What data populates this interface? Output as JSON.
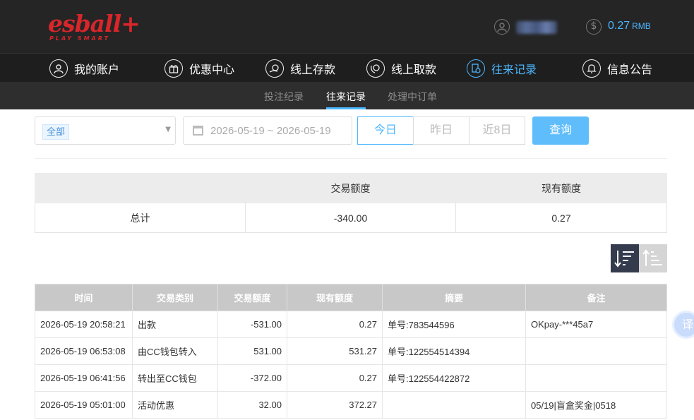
{
  "brand": {
    "logo_text": "esball+",
    "tagline": "PLAY SMART",
    "color": "#d8262b"
  },
  "header": {
    "balance": "0.27",
    "currency": "RMB",
    "accent": "#4cb6ff"
  },
  "nav": [
    {
      "label": "我的账户",
      "icon": "user-icon"
    },
    {
      "label": "优惠中心",
      "icon": "gift-icon"
    },
    {
      "label": "线上存款",
      "icon": "deposit-icon"
    },
    {
      "label": "线上取款",
      "icon": "withdraw-icon"
    },
    {
      "label": "往来记录",
      "icon": "records-icon",
      "active": true
    },
    {
      "label": "信息公告",
      "icon": "bell-icon"
    }
  ],
  "subnav": [
    {
      "label": "投注纪录"
    },
    {
      "label": "往来记录",
      "active": true
    },
    {
      "label": "处理中订单"
    }
  ],
  "filters": {
    "type_value": "全部",
    "date_range": "2026-05-19 ~ 2026-05-19",
    "quick": [
      "今日",
      "昨日",
      "近8日"
    ],
    "search_label": "查询"
  },
  "summary": {
    "headers": [
      "",
      "交易额度",
      "现有额度"
    ],
    "row": [
      "总计",
      "-340.00",
      "0.27"
    ]
  },
  "records": {
    "headers": [
      "时间",
      "交易类别",
      "交易额度",
      "现有额度",
      "摘要",
      "备注"
    ],
    "rows": [
      [
        "2026-05-19 20:58:21",
        "出款",
        "-531.00",
        "0.27",
        "单号:783544596",
        "OKpay-***45a7"
      ],
      [
        "2026-05-19 06:53:08",
        "由CC钱包转入",
        "531.00",
        "531.27",
        "单号:122554514394",
        ""
      ],
      [
        "2026-05-19 06:41:56",
        "转出至CC钱包",
        "-372.00",
        "0.27",
        "单号:122554422872",
        ""
      ],
      [
        "2026-05-19 05:01:00",
        "活动优惠",
        "32.00",
        "372.27",
        "",
        "05/19|盲盒奖金|0518"
      ]
    ]
  },
  "translate_label": "译"
}
